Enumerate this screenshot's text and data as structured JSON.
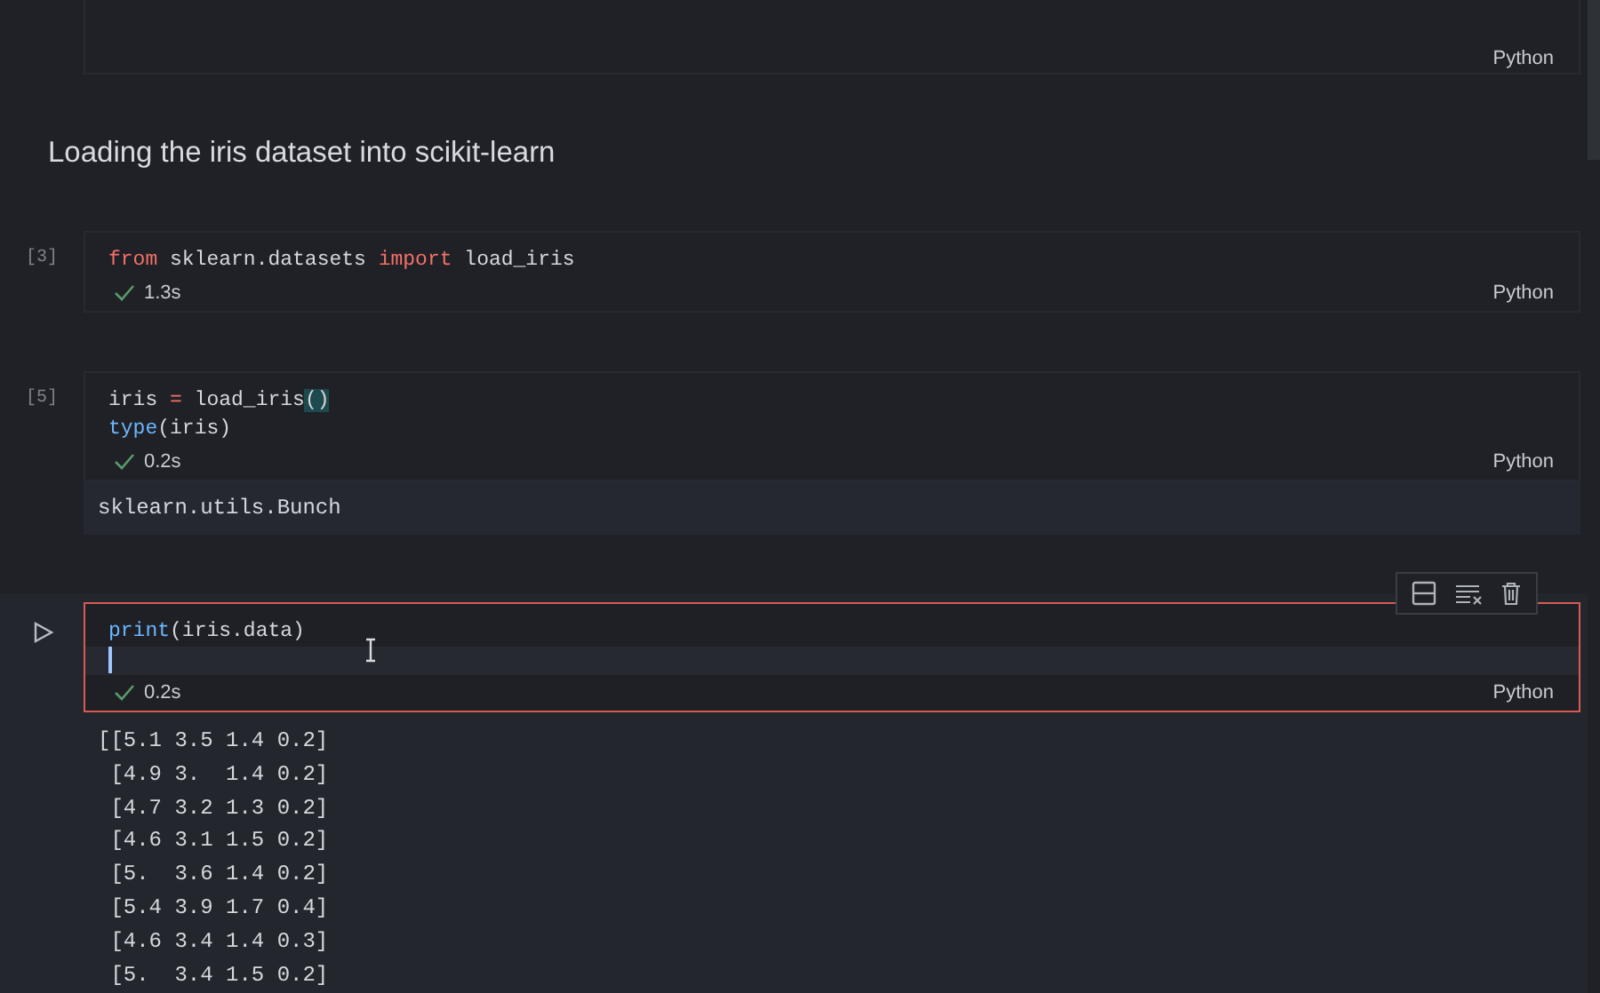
{
  "cells": [
    {
      "kind": "code-cut",
      "selected": false,
      "language": "Python"
    },
    {
      "kind": "markdown",
      "heading": "Loading the iris dataset into scikit-learn"
    },
    {
      "kind": "code",
      "count": "[3]",
      "selected": false,
      "succeeded": true,
      "time": "1.3s",
      "language": "Python",
      "lines": [
        {
          "current": false,
          "tokens": [
            {
              "text": "from",
              "kind": "keyword"
            },
            {
              "text": " sklearn.datasets ",
              "kind": "plain"
            },
            {
              "text": "import",
              "kind": "keyword"
            },
            {
              "text": " load_iris",
              "kind": "symbol"
            }
          ]
        }
      ]
    },
    {
      "kind": "code",
      "count": "[5]",
      "selected": false,
      "succeeded": true,
      "time": "0.2s",
      "language": "Python",
      "lines": [
        {
          "current": false,
          "tokens": [
            {
              "text": "iris ",
              "kind": "plain"
            },
            {
              "text": "=",
              "kind": "operator"
            },
            {
              "text": " load_iris",
              "kind": "plain"
            },
            {
              "text": "()",
              "kind": "match"
            }
          ]
        },
        {
          "current": false,
          "tokens": [
            {
              "text": "type",
              "kind": "builtin"
            },
            {
              "text": "(iris)",
              "kind": "plain"
            }
          ]
        }
      ],
      "output": {
        "kind": "box",
        "lines": [
          "sklearn.utils.Bunch"
        ]
      }
    },
    {
      "kind": "code",
      "selected": true,
      "succeeded": true,
      "time": "0.2s",
      "language": "Python",
      "lines": [
        {
          "current": false,
          "tokens": [
            {
              "text": "print",
              "kind": "builtin"
            },
            {
              "text": "(iris.data)",
              "kind": "plain"
            }
          ]
        },
        {
          "current": true
        }
      ],
      "output": {
        "kind": "plain",
        "lines": [
          "[[5.1 3.5 1.4 0.2]",
          " [4.9 3.  1.4 0.2]",
          " [4.7 3.2 1.3 0.2]",
          " [4.6 3.1 1.5 0.2]",
          " [5.  3.6 1.4 0.2]",
          " [5.4 3.9 1.7 0.4]",
          " [4.6 3.4 1.4 0.3]",
          " [5.  3.4 1.5 0.2]"
        ]
      }
    }
  ]
}
